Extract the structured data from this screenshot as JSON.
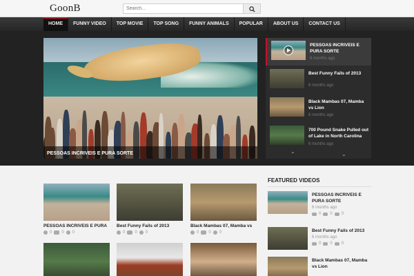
{
  "site": {
    "logo": "GoonB"
  },
  "search": {
    "placeholder": "Search..."
  },
  "nav": {
    "items": [
      "HOME",
      "FUNNY VIDEO",
      "TOP MOVIE",
      "TOP SONG",
      "FUNNY ANIMALS",
      "POPULAR",
      "ABOUT US",
      "CONTACT US"
    ],
    "active": "HOME"
  },
  "slider": {
    "main_caption": "PESSOAS INCRIVEIS E PURA SORTE",
    "items": [
      {
        "title": "PESSOAS INCRIVEIS E PURA SORTE",
        "date": "6 months ago"
      },
      {
        "title": "Best Funny Fails of 2013",
        "date": "6 months ago"
      },
      {
        "title": "Black Mambas 07, Mamba vs Lion",
        "date": "6 months ago"
      },
      {
        "title": "700 Pound Snake Pulled out of Lake in North Carolina",
        "date": "6 months ago"
      }
    ]
  },
  "grid": {
    "cards": [
      {
        "title": "PESSOAS INCRIVEIS E PURA",
        "views": "0",
        "comments": "0",
        "likes": "0"
      },
      {
        "title": "Best Funny Fails of 2013",
        "views": "0",
        "comments": "0",
        "likes": "0"
      },
      {
        "title": "Black Mambas 07, Mamba vs",
        "views": "0",
        "comments": "0",
        "likes": "0"
      }
    ]
  },
  "featured": {
    "heading": "FEATURED VIDEOS",
    "items": [
      {
        "title": "PESSOAS INCRIVEIS E PURA SORTE",
        "date": "6 months ago",
        "views": "0",
        "comments": "0",
        "likes": "0"
      },
      {
        "title": "Best Funny Fails of 2013",
        "date": "6 months ago",
        "views": "0",
        "comments": "0",
        "likes": "0"
      },
      {
        "title": "Black Mambas 07, Mamba vs Lion",
        "date": "",
        "views": "",
        "comments": "",
        "likes": ""
      }
    ]
  },
  "colors": {
    "accent": "#c8102e",
    "nav_bg": "#2e2e2e",
    "feature_bg": "#222222"
  }
}
